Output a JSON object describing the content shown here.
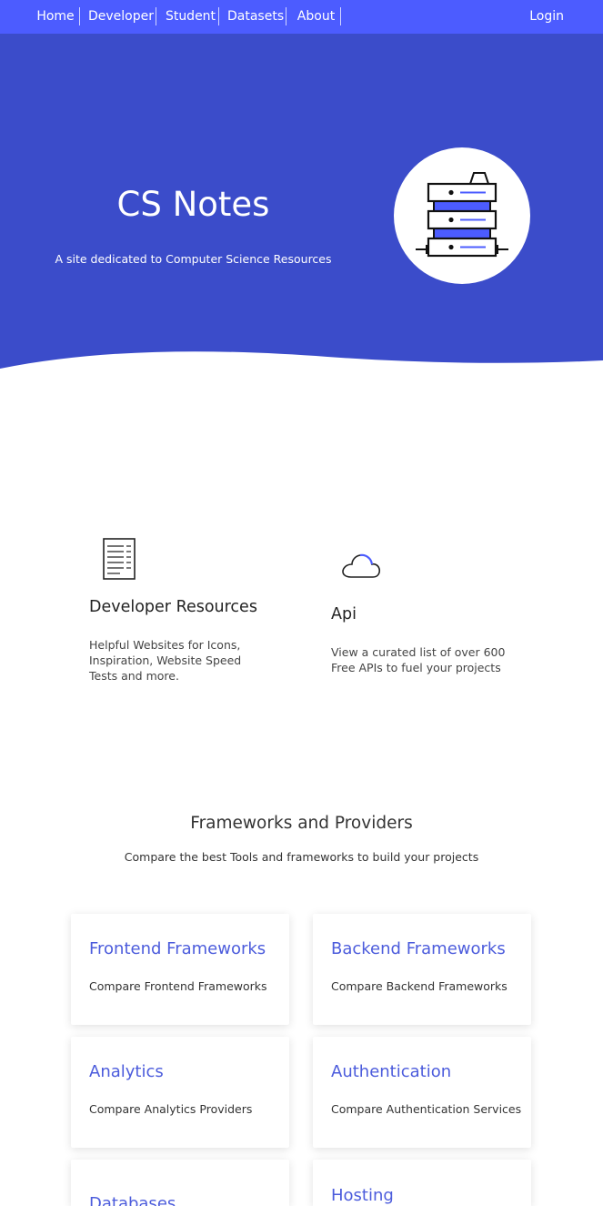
{
  "nav": {
    "items": [
      {
        "label": "Home"
      },
      {
        "label": "Developer"
      },
      {
        "label": "Student"
      },
      {
        "label": "Datasets"
      },
      {
        "label": "About"
      }
    ],
    "login": "Login"
  },
  "hero": {
    "title": "CS Notes",
    "subtitle": "A site dedicated to Computer Science Resources",
    "icon": "server-rack-icon"
  },
  "features": [
    {
      "icon": "document-list-icon",
      "title": "Developer Resources",
      "desc": "Helpful Websites for Icons, Inspiration, Website Speed Tests and more."
    },
    {
      "icon": "cloud-icon",
      "title": "Api",
      "desc": "View a curated list of over 600 Free APIs to fuel your projects"
    }
  ],
  "frameworks": {
    "title": "Frameworks and Providers",
    "subtitle": "Compare the best Tools and frameworks to build your projects",
    "cards": [
      {
        "title": "Frontend Frameworks",
        "desc": "Compare Frontend Frameworks"
      },
      {
        "title": "Backend Frameworks",
        "desc": "Compare Backend Frameworks"
      },
      {
        "title": "Analytics",
        "desc": "Compare Analytics Providers"
      },
      {
        "title": "Authentication",
        "desc": "Compare Authentication Services"
      },
      {
        "title": "Databases",
        "desc": ""
      },
      {
        "title": "Hosting",
        "desc": ""
      }
    ]
  },
  "colors": {
    "nav": "#4c5cff",
    "hero": "#3b4cca",
    "accent": "#4c5cdc"
  }
}
